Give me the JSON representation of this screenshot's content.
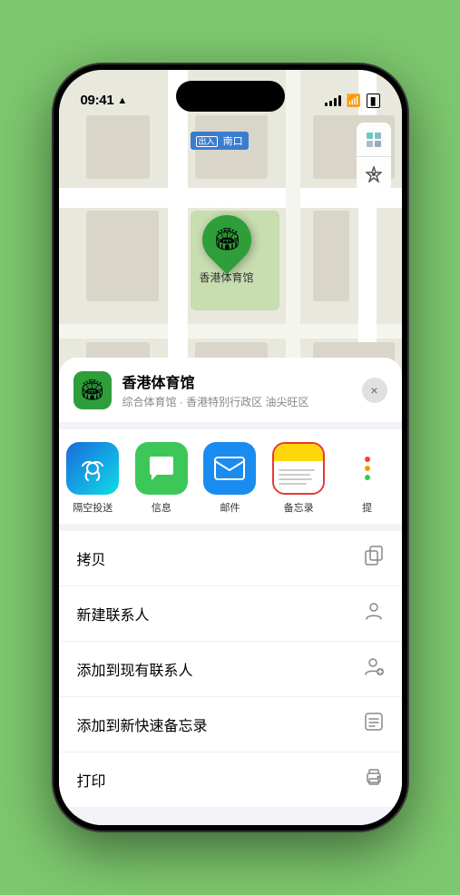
{
  "status_bar": {
    "time": "09:41",
    "location_icon": "▶",
    "signal": "signal",
    "wifi": "wifi",
    "battery": "battery"
  },
  "map": {
    "label_text": "南口",
    "venue_name_on_map": "香港体育馆",
    "control_map_icon": "🗺",
    "control_location_icon": "⬆"
  },
  "venue_info": {
    "name": "香港体育馆",
    "subtitle": "综合体育馆 · 香港特别行政区 油尖旺区",
    "close_label": "×"
  },
  "apps": [
    {
      "id": "airdrop",
      "label": "隔空投送",
      "type": "airdrop"
    },
    {
      "id": "messages",
      "label": "信息",
      "type": "messages"
    },
    {
      "id": "mail",
      "label": "邮件",
      "type": "mail"
    },
    {
      "id": "notes",
      "label": "备忘录",
      "type": "notes"
    },
    {
      "id": "more",
      "label": "提",
      "type": "more"
    }
  ],
  "actions": [
    {
      "id": "copy",
      "label": "拷贝",
      "icon": "copy"
    },
    {
      "id": "new-contact",
      "label": "新建联系人",
      "icon": "person"
    },
    {
      "id": "add-existing",
      "label": "添加到现有联系人",
      "icon": "person-add"
    },
    {
      "id": "add-notes",
      "label": "添加到新快速备忘录",
      "icon": "notes"
    },
    {
      "id": "print",
      "label": "打印",
      "icon": "print"
    }
  ],
  "more_dots": {
    "colors": [
      "#ff3b30",
      "#ff9500",
      "#34c759"
    ]
  }
}
